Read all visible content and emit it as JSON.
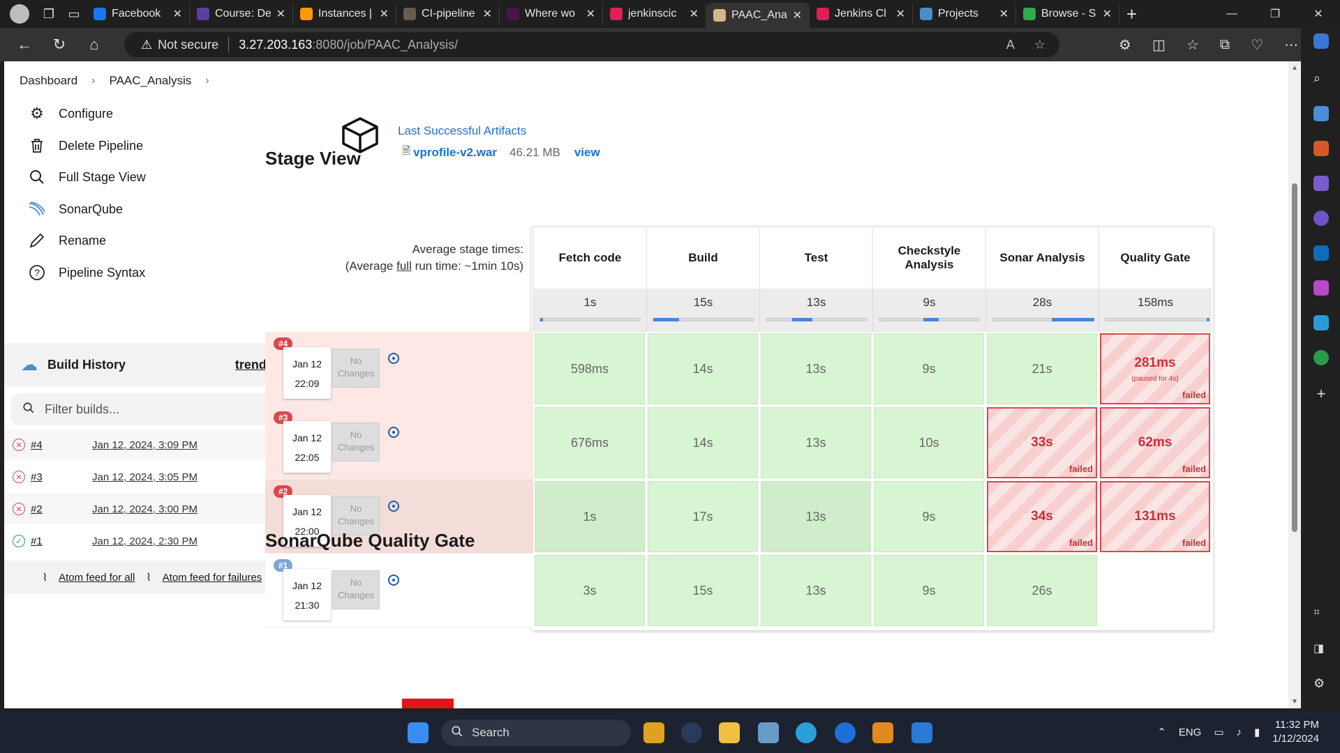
{
  "browser": {
    "tabs": [
      {
        "title": "Facebook",
        "color": "#1877f2",
        "active": false
      },
      {
        "title": "Course: De",
        "color": "#5b3fa0",
        "active": false
      },
      {
        "title": "Instances |",
        "color": "#ff9900",
        "active": false
      },
      {
        "title": "CI-pipeline",
        "color": "#6b5a4e",
        "active": false
      },
      {
        "title": "Where wo",
        "color": "#4a154b",
        "active": false
      },
      {
        "title": "jenkinscic",
        "color": "#e01e5a",
        "active": false
      },
      {
        "title": "PAAC_Ana",
        "color": "#d8b48a",
        "active": true
      },
      {
        "title": "Jenkins Cl",
        "color": "#e01e5a",
        "active": false
      },
      {
        "title": "Projects",
        "color": "#4a8dc8",
        "active": false
      },
      {
        "title": "Browse - S",
        "color": "#2eaa4a",
        "active": false
      }
    ],
    "address": {
      "warning": "Not secure",
      "host": "3.27.203.163",
      "path": ":8080/job/PAAC_Analysis/"
    }
  },
  "breadcrumb": {
    "home": "Dashboard",
    "job": "PAAC_Analysis"
  },
  "sidebar": {
    "items": [
      {
        "label": "Configure",
        "icon": "gear-icon"
      },
      {
        "label": "Delete Pipeline",
        "icon": "trash-icon"
      },
      {
        "label": "Full Stage View",
        "icon": "search-icon"
      },
      {
        "label": "SonarQube",
        "icon": "sonarqube-icon"
      },
      {
        "label": "Rename",
        "icon": "pencil-icon"
      },
      {
        "label": "Pipeline Syntax",
        "icon": "help-icon"
      }
    ],
    "build_history": {
      "title": "Build History",
      "trend": "trend",
      "filter_placeholder": "Filter builds...",
      "filter_shortcut": "/",
      "builds": [
        {
          "number": "#4",
          "date": "Jan 12, 2024, 3:09 PM",
          "status": "failed"
        },
        {
          "number": "#3",
          "date": "Jan 12, 2024, 3:05 PM",
          "status": "failed"
        },
        {
          "number": "#2",
          "date": "Jan 12, 2024, 3:00 PM",
          "status": "failed"
        },
        {
          "number": "#1",
          "date": "Jan 12, 2024, 2:30 PM",
          "status": "success"
        }
      ],
      "atom_all": "Atom feed for all",
      "atom_failures": "Atom feed for failures"
    }
  },
  "artifacts": {
    "title": "Last Successful Artifacts",
    "file": "vprofile-v2.war",
    "size": "46.21 MB",
    "view": "view"
  },
  "stage_view": {
    "title": "Stage View",
    "avg_label": "Average stage times:",
    "avg_run_prefix": "(Average ",
    "avg_run_link": "full",
    "avg_run_suffix": " run time: ~1min 10s)",
    "stages": [
      {
        "name": "Fetch code",
        "avg": "1s",
        "bar_from": 0.0,
        "bar_to": 0.0
      },
      {
        "name": "Build",
        "avg": "15s",
        "bar_from": 0.0,
        "bar_to": 0.25
      },
      {
        "name": "Test",
        "avg": "13s",
        "bar_from": 0.25,
        "bar_to": 0.45
      },
      {
        "name": "Checkstyle Analysis",
        "avg": "9s",
        "bar_from": 0.43,
        "bar_to": 0.58
      },
      {
        "name": "Sonar Analysis",
        "avg": "28s",
        "bar_from": 0.58,
        "bar_to": 1.0
      },
      {
        "name": "Quality Gate",
        "avg": "158ms",
        "bar_from": 0.99,
        "bar_to": 1.0
      }
    ],
    "runs": [
      {
        "badge": "#4",
        "date": "Jan 12",
        "time": "22:09",
        "changes": "No Changes",
        "cells": [
          {
            "value": "598ms",
            "state": "ok"
          },
          {
            "value": "14s",
            "state": "ok"
          },
          {
            "value": "13s",
            "state": "ok"
          },
          {
            "value": "9s",
            "state": "ok"
          },
          {
            "value": "21s",
            "state": "ok"
          },
          {
            "value": "281ms",
            "state": "failed",
            "note": "(paused for 4s)",
            "tag": "failed"
          }
        ]
      },
      {
        "badge": "#3",
        "date": "Jan 12",
        "time": "22:05",
        "changes": "No Changes",
        "cells": [
          {
            "value": "676ms",
            "state": "ok"
          },
          {
            "value": "14s",
            "state": "ok"
          },
          {
            "value": "13s",
            "state": "ok"
          },
          {
            "value": "10s",
            "state": "ok"
          },
          {
            "value": "33s",
            "state": "failed",
            "tag": "failed"
          },
          {
            "value": "62ms",
            "state": "failed",
            "tag": "failed"
          }
        ]
      },
      {
        "badge": "#2",
        "date": "Jan 12",
        "time": "22:00",
        "changes": "No Changes",
        "cells": [
          {
            "value": "1s",
            "state": "ok"
          },
          {
            "value": "17s",
            "state": "ok"
          },
          {
            "value": "13s",
            "state": "ok"
          },
          {
            "value": "9s",
            "state": "ok"
          },
          {
            "value": "34s",
            "state": "failed",
            "tag": "failed"
          },
          {
            "value": "131ms",
            "state": "failed",
            "tag": "failed"
          }
        ]
      },
      {
        "badge": "#1",
        "date": "Jan 12",
        "time": "21:30",
        "changes": "No Changes",
        "cells": [
          {
            "value": "3s",
            "state": "ok"
          },
          {
            "value": "15s",
            "state": "ok"
          },
          {
            "value": "13s",
            "state": "ok"
          },
          {
            "value": "9s",
            "state": "ok"
          },
          {
            "value": "26s",
            "state": "ok"
          },
          {
            "value": "",
            "state": "empty"
          }
        ]
      }
    ]
  },
  "quality_gate": {
    "title": "SonarQube Quality Gate"
  },
  "taskbar": {
    "search": "Search",
    "lang": "ENG",
    "time": "11:32 PM",
    "date": "1/12/2024"
  },
  "colors": {
    "link": "#1d6fd2",
    "failed": "#d9474d",
    "success_cell": "#d8f5d3",
    "failed_row": "#fde8e6"
  }
}
